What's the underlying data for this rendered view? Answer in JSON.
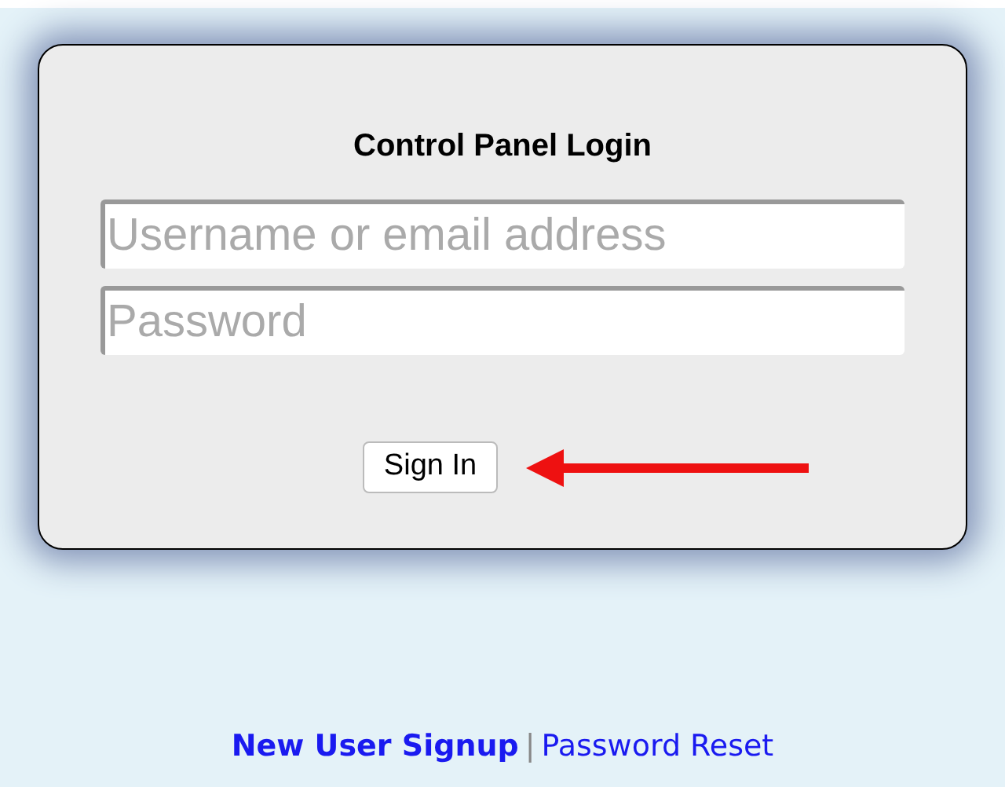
{
  "panel": {
    "title": "Control Panel Login",
    "fields": [
      {
        "placeholder": "Username or email address"
      },
      {
        "placeholder": "Password"
      }
    ],
    "button": "Sign In"
  },
  "links": [
    {
      "label": "New User Signup",
      "bold": true
    },
    {
      "label": "Password Reset",
      "bold": false
    }
  ],
  "separator": "|"
}
